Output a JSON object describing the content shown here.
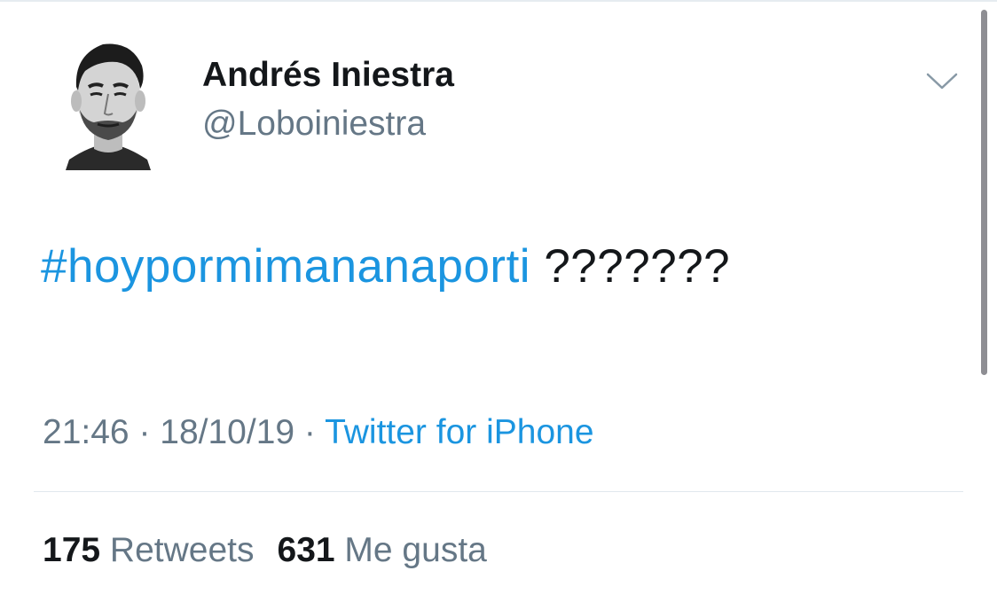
{
  "user": {
    "display_name": "Andrés Iniestra",
    "handle": "@Loboiniestra",
    "avatar_icon": "profile-photo"
  },
  "menu": {
    "icon": "chevron-down-icon"
  },
  "tweet": {
    "hashtag": "#hoypormimananaporti",
    "text_suffix": " ???????"
  },
  "meta": {
    "time": "21:46",
    "separator_1": " · ",
    "date": "18/10/19",
    "separator_2": " · ",
    "source": "Twitter for iPhone"
  },
  "stats": {
    "retweets_count": "175",
    "retweets_label": "Retweets",
    "likes_count": "631",
    "likes_label": "Me gusta"
  },
  "colors": {
    "link_blue": "#1b95e0",
    "secondary_gray": "#657786",
    "primary_text": "#14171a"
  }
}
